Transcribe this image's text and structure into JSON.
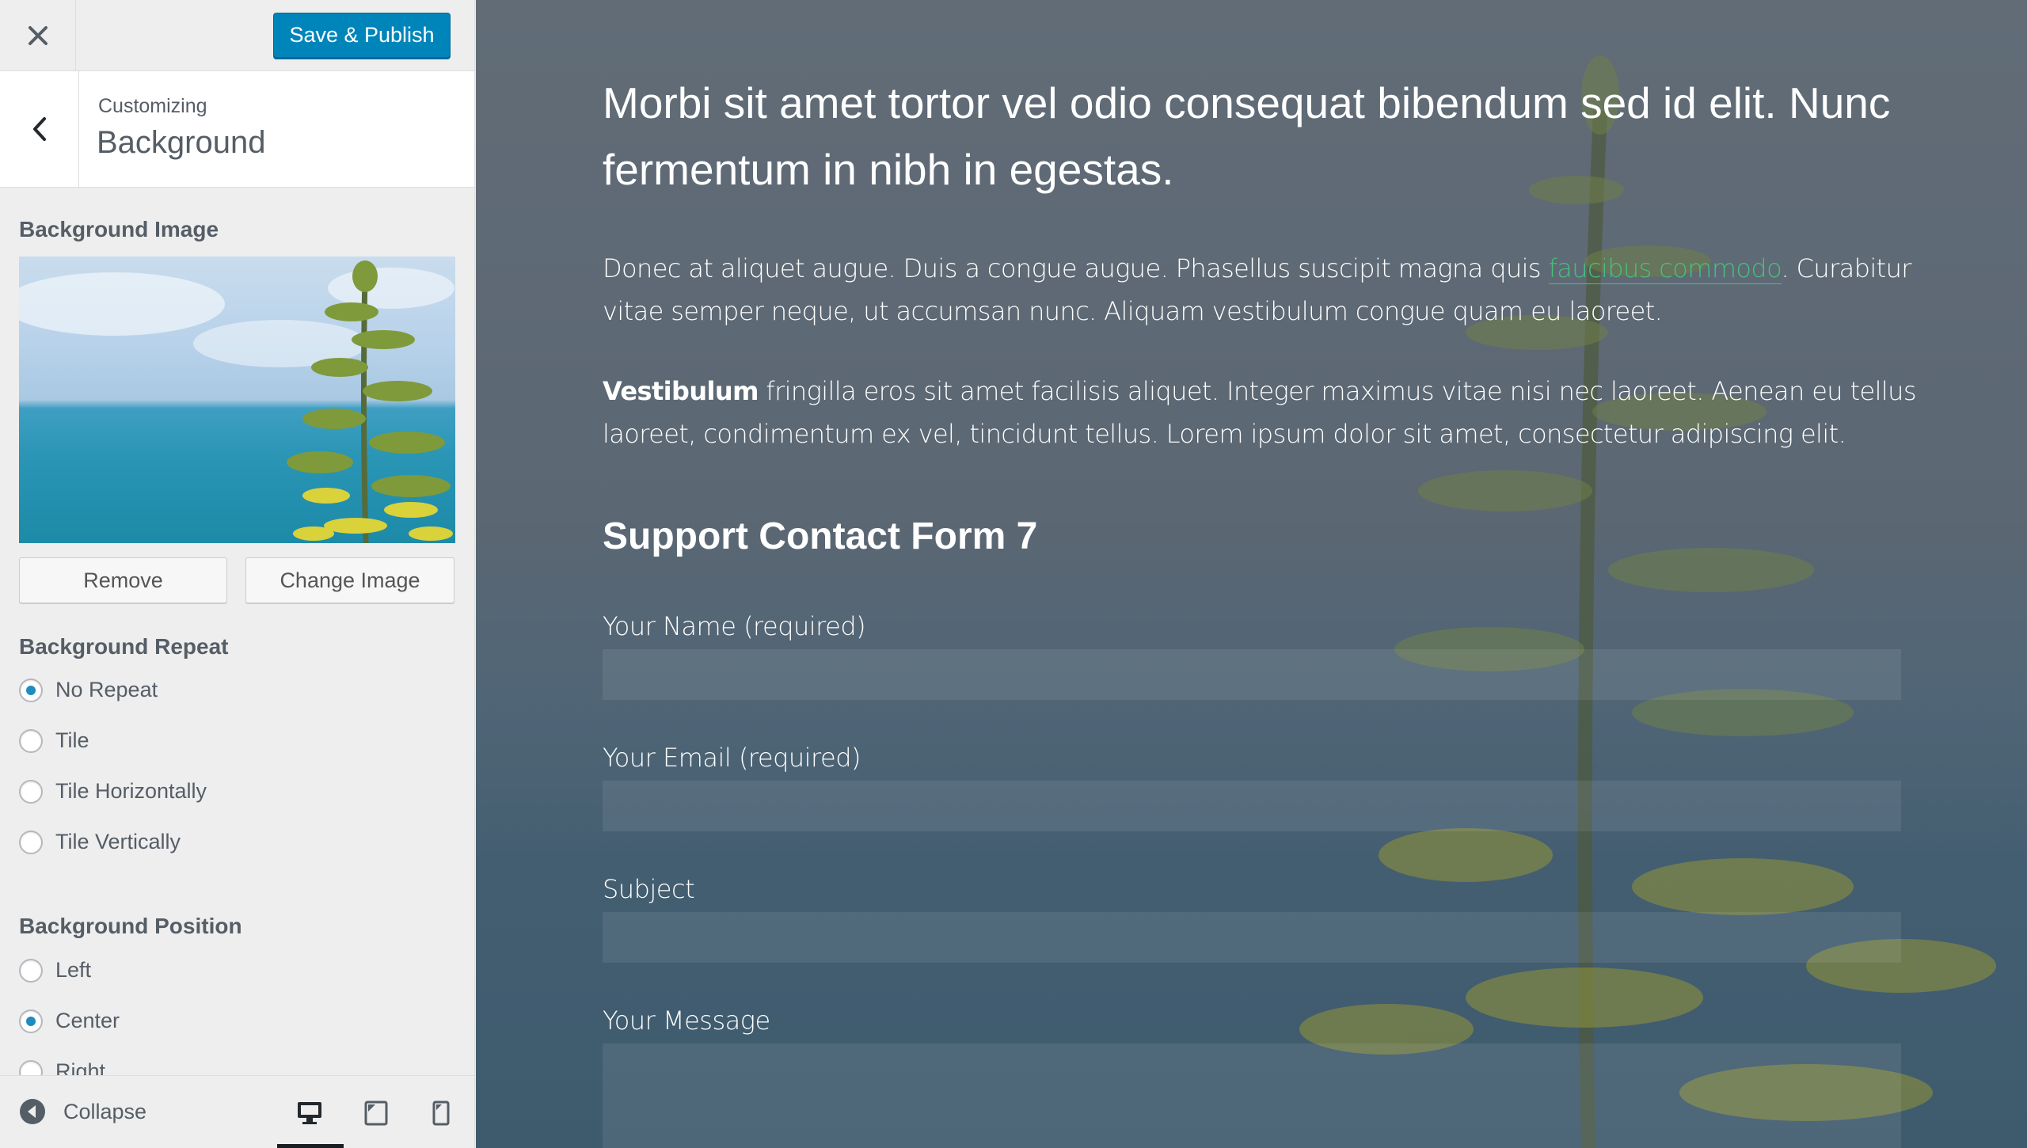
{
  "topbar": {
    "close_icon": "close-icon",
    "publish_label": "Save & Publish"
  },
  "section": {
    "back_icon": "chevron-left-icon",
    "customizing_label": "Customizing",
    "title": "Background"
  },
  "background_image": {
    "title": "Background Image",
    "remove_label": "Remove",
    "change_label": "Change Image"
  },
  "background_repeat": {
    "title": "Background Repeat",
    "options": [
      {
        "label": "No Repeat",
        "checked": true
      },
      {
        "label": "Tile",
        "checked": false
      },
      {
        "label": "Tile Horizontally",
        "checked": false
      },
      {
        "label": "Tile Vertically",
        "checked": false
      }
    ]
  },
  "background_position": {
    "title": "Background Position",
    "options": [
      {
        "label": "Left",
        "checked": false
      },
      {
        "label": "Center",
        "checked": true
      },
      {
        "label": "Right",
        "checked": false
      }
    ]
  },
  "footer": {
    "collapse_label": "Collapse",
    "devices": [
      "desktop-icon",
      "tablet-icon",
      "mobile-icon"
    ],
    "active_device": "desktop"
  },
  "preview": {
    "intro": "Morbi sit amet tortor vel odio consequat bibendum sed id elit. Nunc fermentum in nibh in egestas.",
    "para1_before": "Donec at aliquet augue. Duis a congue augue. Phasellus suscipit magna quis ",
    "para1_link": "faucibus commodo",
    "para1_after": ". Curabitur vitae semper neque, ut accumsan nunc. Aliquam vestibulum congue quam eu laoreet.",
    "para2_bold": "Vestibulum",
    "para2_rest": " fringilla eros sit amet facilisis aliquet. Integer maximus vitae nisi nec laoreet. Aenean eu tellus laoreet, condimentum ex vel, tincidunt tellus. Lorem ipsum dolor sit amet, consectetur adipiscing elit.",
    "form_title": "Support Contact Form 7",
    "fields": [
      {
        "label": "Your Name (required)"
      },
      {
        "label": "Your Email (required)"
      },
      {
        "label": "Subject"
      },
      {
        "label": "Your Message"
      }
    ]
  },
  "colors": {
    "primary": "#0085ba",
    "radio_checked": "#1e8cbe",
    "link": "#48c07a",
    "text_dark": "#555d66"
  }
}
